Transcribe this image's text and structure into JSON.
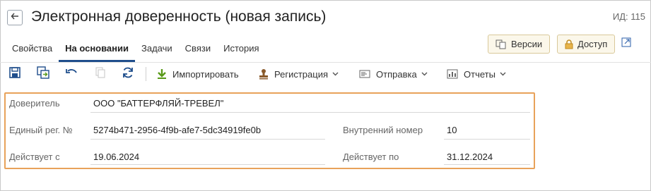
{
  "header": {
    "title": "Электронная доверенность (новая запись)",
    "id_label": "ИД: 115"
  },
  "tabs": [
    {
      "label": "Свойства",
      "active": false
    },
    {
      "label": "На основании",
      "active": true
    },
    {
      "label": "Задачи",
      "active": false
    },
    {
      "label": "Связи",
      "active": false
    },
    {
      "label": "История",
      "active": false
    }
  ],
  "header_buttons": {
    "versions": "Версии",
    "access": "Доступ"
  },
  "toolbar": {
    "import": "Импортировать",
    "registration": "Регистрация",
    "send": "Отправка",
    "reports": "Отчеты"
  },
  "form": {
    "principal_label": "Доверитель",
    "principal_value": "ООО \"БАТТЕРФЛЯЙ-ТРЕВЕЛ\"",
    "reg_no_label": "Единый рег. №",
    "reg_no_value": "5274b471-2956-4f9b-afe7-5dc34919fe0b",
    "internal_no_label": "Внутренний номер",
    "internal_no_value": "10",
    "valid_from_label": "Действует с",
    "valid_from_value": "19.06.2024",
    "valid_to_label": "Действует по",
    "valid_to_value": "31.12.2024"
  },
  "colors": {
    "accent_blue": "#1f4e8c",
    "highlight_orange": "#e8a25a",
    "icon_green": "#5a9a1a",
    "icon_brown": "#8a5a2b"
  }
}
